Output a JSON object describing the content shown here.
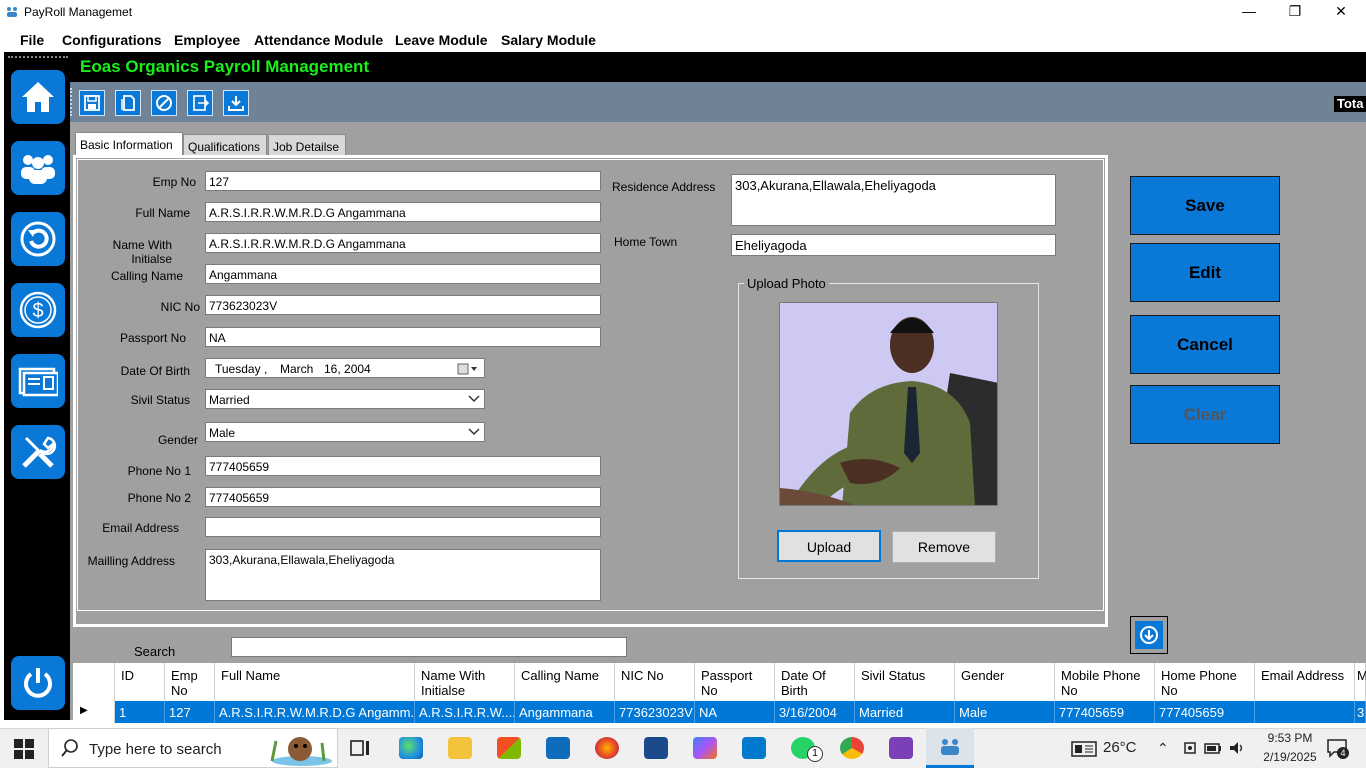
{
  "window": {
    "title": "PayRoll Managemet",
    "minimize": "—",
    "restore": "❐",
    "close": "✕"
  },
  "menu": [
    "File",
    "Configurations",
    "Employee",
    "Attendance Module",
    "Leave Module",
    "Salary Module"
  ],
  "header": {
    "title": "Eoas Organics Payroll Management",
    "total_label": "Tota"
  },
  "tabs": [
    "Basic Information",
    "Qualifications",
    "Job Detailse"
  ],
  "form": {
    "emp_no": {
      "label": "Emp No",
      "value": "127"
    },
    "full_name": {
      "label": "Full Name",
      "value": "A.R.S.I.R.R.W.M.R.D.G Angammana"
    },
    "name_initials": {
      "label": "Name With Initialse",
      "value": "A.R.S.I.R.R.W.M.R.D.G Angammana"
    },
    "calling_name": {
      "label": "Calling Name",
      "value": "Angammana"
    },
    "nic": {
      "label": "NIC No",
      "value": "773623023V"
    },
    "passport": {
      "label": "Passport No",
      "value": "NA"
    },
    "dob": {
      "label": "Date Of Birth",
      "day": "Tuesday",
      "sep": ",",
      "month": "March",
      "rest": "16, 2004"
    },
    "civil": {
      "label": "Sivil Status",
      "value": "Married"
    },
    "gender": {
      "label": "Gender",
      "value": "Male"
    },
    "phone1": {
      "label": "Phone No 1",
      "value": "777405659"
    },
    "phone2": {
      "label": "Phone No 2",
      "value": "777405659"
    },
    "email": {
      "label": "Email Address",
      "value": ""
    },
    "mailing": {
      "label": "Mailling Address",
      "value": "303,Akurana,Ellawala,Eheliyagoda"
    },
    "residence": {
      "label": "Residence Address",
      "value": "303,Akurana,Ellawala,Eheliyagoda"
    },
    "hometown": {
      "label": "Home Town",
      "value": "Eheliyagoda"
    }
  },
  "photo": {
    "group_label": "Upload Photo",
    "upload": "Upload",
    "remove": "Remove"
  },
  "actions": {
    "save": "Save",
    "edit": "Edit",
    "cancel": "Cancel",
    "clear": "Clear"
  },
  "search": {
    "label": "Search",
    "value": ""
  },
  "grid": {
    "columns": [
      "ID",
      "Emp No",
      "Full Name",
      "Name With Initialse",
      "Calling Name",
      "NIC No",
      "Passport No",
      "Date Of Birth",
      "Sivil Status",
      "Gender",
      "Mobile Phone No",
      "Home Phone No",
      "Email Address",
      "M"
    ],
    "row": [
      "1",
      "127",
      "A.R.S.I.R.R.W.M.R.D.G Angamm...",
      "A.R.S.I.R.R.W....",
      "Angammana",
      "773623023V",
      "NA",
      "3/16/2004",
      "Married",
      "Male",
      "777405659",
      "777405659",
      "",
      "3"
    ]
  },
  "taskbar": {
    "search_placeholder": "Type here to search",
    "temperature": "26°C",
    "time": "9:53 PM",
    "date": "2/19/2025",
    "notification_count": "4",
    "whatsapp_badge": "1"
  },
  "colors": {
    "accent": "#0a78d7",
    "header_text": "#19f019",
    "panel": "#a0a0a0",
    "toolbar": "#6f8296"
  }
}
